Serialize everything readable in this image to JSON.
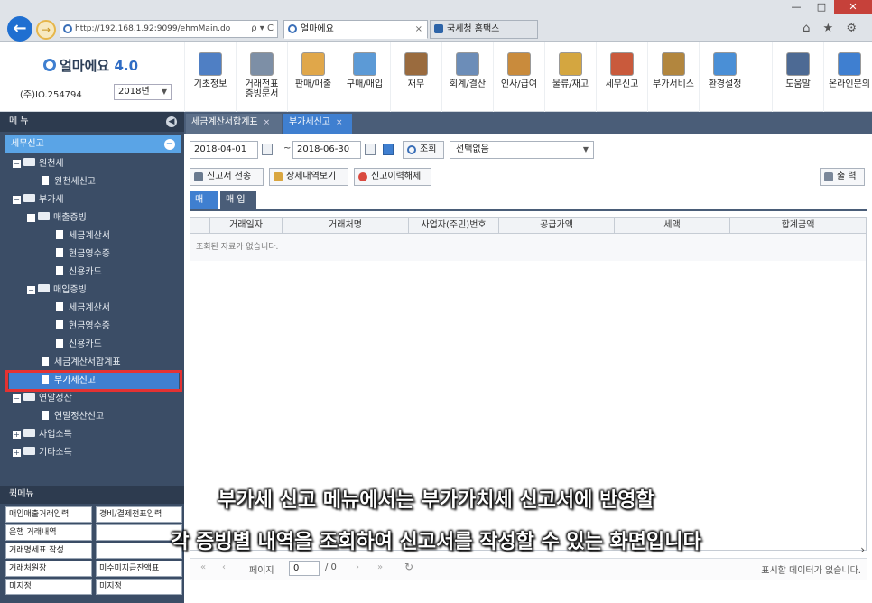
{
  "browser": {
    "url": "http://192.168.1.92:9099/ehmMain.do",
    "addr_tools": "ρ ▾ C",
    "tabs": [
      {
        "label": "얼마에요",
        "close": "×"
      },
      {
        "label": "국세청 홈택스"
      }
    ],
    "window_buttons": {
      "minimize": "—",
      "maximize": "□",
      "close": "✕"
    },
    "toolbar_icons": "⌂ ★ ⚙",
    "back_glyph": "←"
  },
  "app": {
    "logo": "얼마에요",
    "logo_version": "4.0",
    "company": "(주)IO.254794",
    "year": "2018년",
    "menu": [
      {
        "label": "기초정보",
        "icon": "ledger-icon"
      },
      {
        "label": "거래전표\n증빙문서",
        "icon": "voucher-icon"
      },
      {
        "label": "판매/매출",
        "icon": "sales-icon"
      },
      {
        "label": "구매/매입",
        "icon": "purchase-icon"
      },
      {
        "label": "재무",
        "icon": "finance-icon"
      },
      {
        "label": "회계/결산",
        "icon": "accounting-icon"
      },
      {
        "label": "인사/급여",
        "icon": "hr-icon"
      },
      {
        "label": "물류/재고",
        "icon": "logistics-icon"
      },
      {
        "label": "세무신고",
        "icon": "tax-icon"
      },
      {
        "label": "부가서비스",
        "icon": "service-icon"
      },
      {
        "label": "환경설정",
        "icon": "settings-icon"
      },
      {
        "label": "도움말",
        "icon": "help-icon"
      },
      {
        "label": "온라인문의",
        "icon": "online-inquiry-icon"
      }
    ]
  },
  "sidebar": {
    "title": "메 뉴",
    "section": "세무신고",
    "tree": [
      {
        "label": "원천세",
        "type": "folder",
        "toggle": "−"
      },
      {
        "label": "원천세신고",
        "type": "doc"
      },
      {
        "label": "부가세",
        "type": "folder",
        "toggle": "−"
      },
      {
        "label": "매출증빙",
        "type": "folder",
        "toggle": "−"
      },
      {
        "label": "세금계산서",
        "type": "doc"
      },
      {
        "label": "현금영수증",
        "type": "doc"
      },
      {
        "label": "신용카드",
        "type": "doc"
      },
      {
        "label": "매입증빙",
        "type": "folder",
        "toggle": "−"
      },
      {
        "label": "세금계산서",
        "type": "doc"
      },
      {
        "label": "현금영수증",
        "type": "doc"
      },
      {
        "label": "신용카드",
        "type": "doc"
      },
      {
        "label": "세금계산서합계표",
        "type": "doc"
      },
      {
        "label": "부가세신고",
        "type": "doc",
        "selected": true
      },
      {
        "label": "연말정산",
        "type": "folder",
        "toggle": "−"
      },
      {
        "label": "연말정산신고",
        "type": "doc"
      },
      {
        "label": "사업소득",
        "type": "folder",
        "toggle": "+"
      },
      {
        "label": "기타소득",
        "type": "folder",
        "toggle": "+"
      }
    ],
    "quick_title": "퀵메뉴",
    "quick_buttons": [
      "매입매출거래입력",
      "경비/결제전표입력",
      "은행 거래내역",
      "",
      "거래명세표 작성",
      "",
      "거래처원장",
      "미수미지급잔액표",
      "미지정",
      "미지정"
    ]
  },
  "main": {
    "tabs": [
      {
        "label": "세금계산서합계표",
        "close": "×"
      },
      {
        "label": "부가세신고",
        "close": "×"
      }
    ],
    "filter": {
      "date_from": "2018-04-01",
      "tilde": "~",
      "date_to": "2018-06-30",
      "search_label": "조회",
      "select_value": "선택없음"
    },
    "actions": {
      "send_label": "신고서 전송",
      "detail_label": "상세내역보기",
      "cancel_label": "신고이력해제",
      "print_label": "출 력"
    },
    "subtabs": [
      "매 출",
      "매 입"
    ],
    "grid": {
      "columns": [
        "",
        "거래일자",
        "거래처명",
        "사업자(주민)번호",
        "공급가액",
        "세액",
        "합계금액"
      ],
      "empty_text": "조회된 자료가 없습니다."
    },
    "pager": {
      "page_label": "페이지",
      "page_value": "0",
      "page_total": "/ 0",
      "status": "표시할 데이터가 없습니다.",
      "nav_first": "«",
      "nav_prev": "‹",
      "nav_next": "›",
      "nav_last": "»",
      "refresh": "↻"
    },
    "scroll_arrow": "›"
  },
  "subtitles": {
    "line1": "부가세 신고 메뉴에서는 부가가치세 신고서에 반영할",
    "line2": "각 증빙별 내역을 조회하여 신고서를 작성할 수 있는 화면입니다"
  },
  "colors": {
    "accent": "#3f7fd0",
    "sidebar_bg": "#3b4d66",
    "highlight": "#e43232",
    "section": "#5aa4e6"
  }
}
